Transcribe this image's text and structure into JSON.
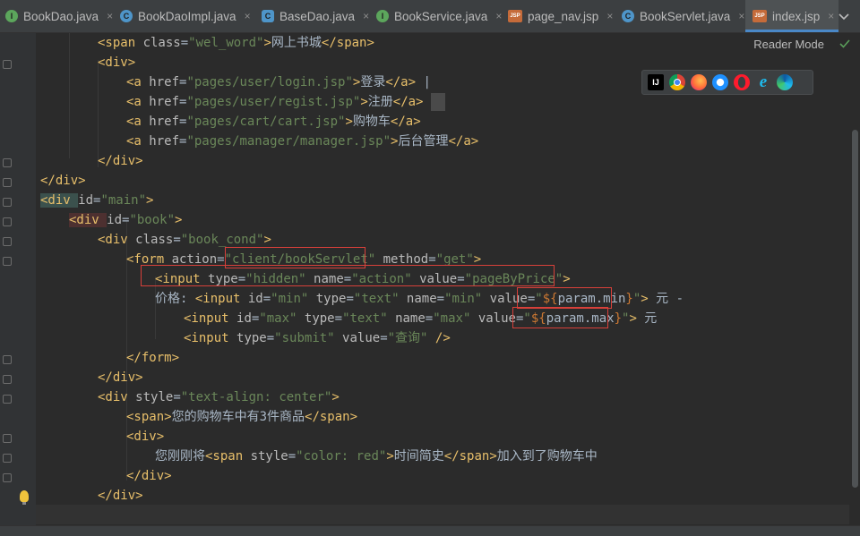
{
  "tabs": [
    {
      "label": "BookDao.java",
      "icon": "interface-icon",
      "icon_text": "I"
    },
    {
      "label": "BookDaoImpl.java",
      "icon": "class-icon",
      "icon_text": "C"
    },
    {
      "label": "BaseDao.java",
      "icon": "abstract-class-icon",
      "icon_text": "C"
    },
    {
      "label": "BookService.java",
      "icon": "interface-icon",
      "icon_text": "I"
    },
    {
      "label": "page_nav.jsp",
      "icon": "jsp-icon",
      "icon_text": "JSP"
    },
    {
      "label": "BookServlet.java",
      "icon": "class-icon",
      "icon_text": "C"
    },
    {
      "label": "index.jsp",
      "icon": "jsp-icon",
      "icon_text": "JSP",
      "active": true
    }
  ],
  "tab_close_glyph": "×",
  "reader_mode": "Reader Mode",
  "browser_icon_text": "IJ",
  "code": {
    "l1": {
      "a": "<span ",
      "b": "class",
      "c": "=",
      "d": "\"wel_word\"",
      "e": ">",
      "f": "网上书城",
      "g": "</span>"
    },
    "l2": {
      "a": "<div>"
    },
    "l3": {
      "a": "<a ",
      "b": "href",
      "c": "=",
      "d": "\"pages/user/login.jsp\"",
      "e": ">",
      "f": "登录",
      "g": "</a>",
      "h": " |"
    },
    "l4": {
      "a": "<a ",
      "b": "href",
      "c": "=",
      "d": "\"pages/user/regist.jsp\"",
      "e": ">",
      "f": "注册",
      "g": "</a>"
    },
    "l5": {
      "a": "<a ",
      "b": "href",
      "c": "=",
      "d": "\"pages/cart/cart.jsp\"",
      "e": ">",
      "f": "购物车",
      "g": "</a>"
    },
    "l6": {
      "a": "<a ",
      "b": "href",
      "c": "=",
      "d": "\"pages/manager/manager.jsp\"",
      "e": ">",
      "f": "后台管理",
      "g": "</a>"
    },
    "l7": {
      "a": "</div>"
    },
    "l8": {
      "a": "</div>"
    },
    "l9": {
      "a": "<div ",
      "b": "id",
      "c": "=",
      "d": "\"main\"",
      "e": ">"
    },
    "l10": {
      "a": "<div ",
      "b": "id",
      "c": "=",
      "d": "\"book\"",
      "e": ">"
    },
    "l11": {
      "a": "<div ",
      "b": "class",
      "c": "=",
      "d": "\"book_cond\"",
      "e": ">"
    },
    "l12": {
      "a": "<form ",
      "b": "action",
      "c": "=",
      "d": "\"",
      "d2": "client/bookServlet",
      "d3": "\"",
      "b2": " method",
      "c2": "=",
      "d4": "\"get\"",
      "e": ">"
    },
    "l13": {
      "a": "<input ",
      "b": "type",
      "c": "=",
      "d": "\"hidden\"",
      "b2": " name",
      "c2": "=",
      "d2": "\"action\"",
      "b3": " value",
      "c3": "=",
      "d3": "\"pageByPrice\"",
      "e": ">"
    },
    "l14": {
      "f": "价格: ",
      "a": "<input ",
      "b": "id",
      "c": "=",
      "d": "\"min\"",
      "b2": " type",
      "c2": "=",
      "d2": "\"text\"",
      "b3": " name",
      "c3": "=",
      "d3": "\"min\"",
      "b4": " value",
      "c4": "=",
      "q": "\"",
      "el1": "${",
      "ev": "param.min",
      "el2": "}",
      "q2": "\"",
      "e": ">",
      "t": " 元 -"
    },
    "l15": {
      "a": "<input ",
      "b": "id",
      "c": "=",
      "d": "\"max\"",
      "b2": " type",
      "c2": "=",
      "d2": "\"text\"",
      "b3": " name",
      "c3": "=",
      "d3": "\"max\"",
      "b4": " value",
      "c4": "=",
      "q": "\"",
      "el1": "${",
      "ev": "param.max",
      "el2": "}",
      "q2": "\"",
      "e": ">",
      "t": " 元"
    },
    "l16": {
      "a": "<input ",
      "b": "type",
      "c": "=",
      "d": "\"submit\"",
      "b2": " value",
      "c2": "=",
      "d2": "\"查询\"",
      "e": " />"
    },
    "l17": {
      "a": "</form>"
    },
    "l18": {
      "a": "</div>"
    },
    "l19": {
      "a": "<div ",
      "b": "style",
      "c": "=",
      "d": "\"text-align: center\"",
      "e": ">"
    },
    "l20": {
      "a": "<span>",
      "f": "您的购物车中有3件商品",
      "g": "</span>"
    },
    "l21": {
      "a": "<div>"
    },
    "l22": {
      "f": "您刚刚将",
      "a": "<span ",
      "b": "style",
      "c": "=",
      "d": "\"color: red\"",
      "e": ">",
      "f2": "时间简史",
      "g": "</span>",
      "f3": "加入到了购物车中"
    },
    "l23": {
      "a": "</div>"
    },
    "l24": {
      "a": "</div>"
    }
  }
}
